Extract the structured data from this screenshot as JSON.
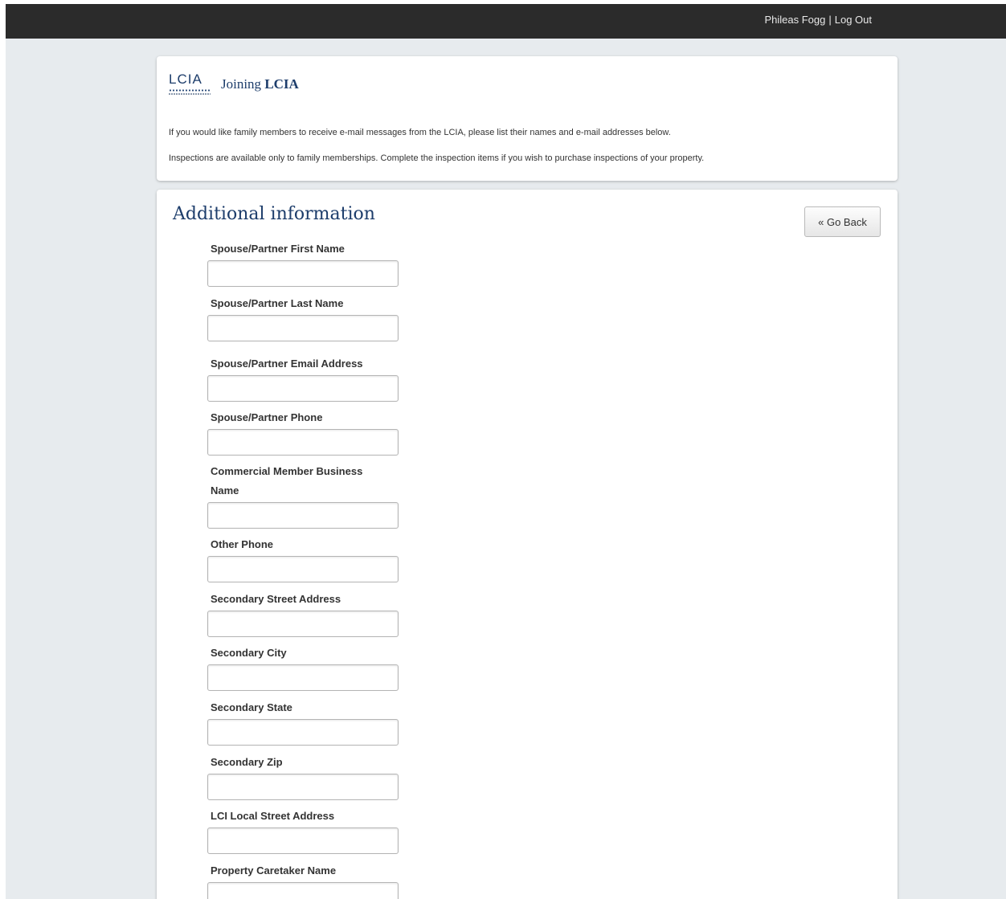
{
  "header": {
    "user_name": "Phileas Fogg",
    "separator": "|",
    "logout_label": "Log Out"
  },
  "brand": {
    "logo_text": "LCIA",
    "title_prefix": "Joining",
    "title_bold": "LCIA"
  },
  "intro": {
    "line1": "If you would like family members to receive e-mail messages from the LCIA, please list their names and e-mail addresses below.",
    "line2": "Inspections are available only to family memberships. Complete the inspection items if you wish to purchase inspections of your property."
  },
  "form": {
    "section_title": "Additional information",
    "back_button_label": "« Go Back",
    "fields": [
      {
        "label": "Spouse/Partner First Name",
        "value": ""
      },
      {
        "label": "Spouse/Partner Last Name",
        "value": ""
      },
      {
        "label": "Spouse/Partner Email Address",
        "value": ""
      },
      {
        "label": "Spouse/Partner Phone",
        "value": ""
      },
      {
        "label": "Commercial Member Business Name",
        "value": ""
      },
      {
        "label": "Other Phone",
        "value": ""
      },
      {
        "label": "Secondary Street Address",
        "value": ""
      },
      {
        "label": "Secondary City",
        "value": ""
      },
      {
        "label": "Secondary State",
        "value": ""
      },
      {
        "label": "Secondary Zip",
        "value": ""
      },
      {
        "label": "LCI Local Street Address",
        "value": ""
      },
      {
        "label": "Property Caretaker Name",
        "value": ""
      }
    ]
  },
  "colors": {
    "topbar": "#2b2b2b",
    "background": "#e7ebee",
    "brand_blue": "#1d3d6b"
  }
}
